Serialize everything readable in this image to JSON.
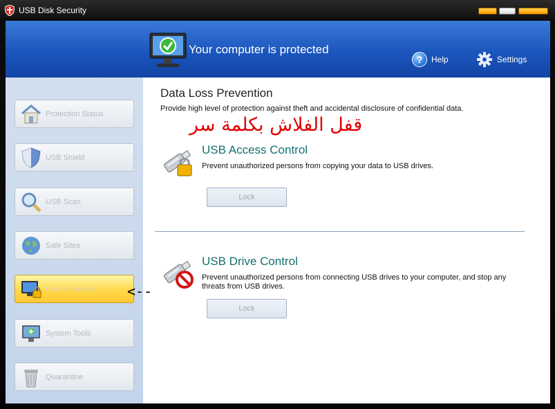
{
  "window": {
    "title": "USB Disk Security",
    "accent_header": "#1b56bd",
    "accent_highlight": "#ffd84a"
  },
  "header": {
    "status": "Your computer is protected",
    "help_label": "Help",
    "settings_label": "Settings"
  },
  "sidebar": {
    "items": [
      {
        "label": "Protection Status",
        "icon": "house-icon",
        "active": false
      },
      {
        "label": "USB Shield",
        "icon": "shield-icon",
        "active": false
      },
      {
        "label": "USB Scan",
        "icon": "magnifier-icon",
        "active": false
      },
      {
        "label": "Safe Sites",
        "icon": "globe-icon",
        "active": false
      },
      {
        "label": "Data Protection",
        "icon": "data-protection-icon",
        "active": true
      },
      {
        "label": "System Tools",
        "icon": "system-tools-icon",
        "active": false
      },
      {
        "label": "Quarantine",
        "icon": "trash-bin-icon",
        "active": false
      }
    ]
  },
  "main": {
    "title": "Data Loss Prevention",
    "description": "Provide high level of protection against theft and accidental disclosure of confidential data.",
    "annotation_arabic": "قفل الفلاش بكلمة سر",
    "features": [
      {
        "title": "USB Access Control",
        "description": "Prevent unauthorized persons from copying your data to USB drives.",
        "button": "Lock",
        "icon": "usb-lock-icon"
      },
      {
        "title": "USB Drive Control",
        "description": "Prevent unauthorized persons from connecting USB drives to your computer, and stop any threats from USB drives.",
        "button": "Lock",
        "icon": "usb-blocked-icon"
      }
    ]
  },
  "annotation_arrow": "<--"
}
